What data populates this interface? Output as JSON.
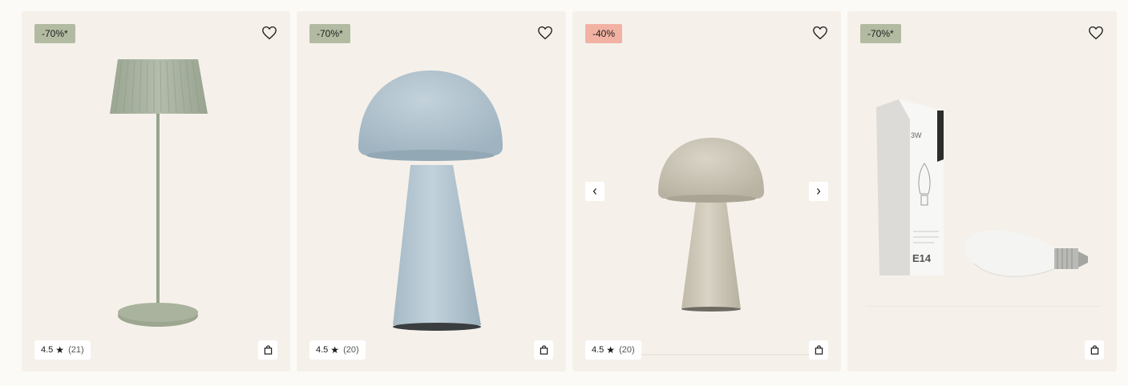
{
  "products": [
    {
      "badge": "-70%*",
      "badge_color": "#b2bba1",
      "rating": "4.5",
      "reviews": "(21)",
      "image": "sage-green pleated-shade floor lamp"
    },
    {
      "badge": "-70%*",
      "badge_color": "#b2bba1",
      "rating": "4.5",
      "reviews": "(20)",
      "image": "light blue mushroom table lamp"
    },
    {
      "badge": "-40%",
      "badge_color": "#f2b2a3",
      "rating": "4.5",
      "reviews": "(20)",
      "image": "beige mushroom table lamp"
    },
    {
      "badge": "-70%*",
      "badge_color": "#b2bba1",
      "image": "E14 LED candle bulb with box",
      "box_text": {
        "wattage": "3W",
        "socket": "E14"
      }
    }
  ],
  "icons": {
    "wishlist": "heart-icon",
    "cart": "shopping-bag-icon",
    "star": "star-icon",
    "prev": "chevron-left-icon",
    "next": "chevron-right-icon"
  }
}
